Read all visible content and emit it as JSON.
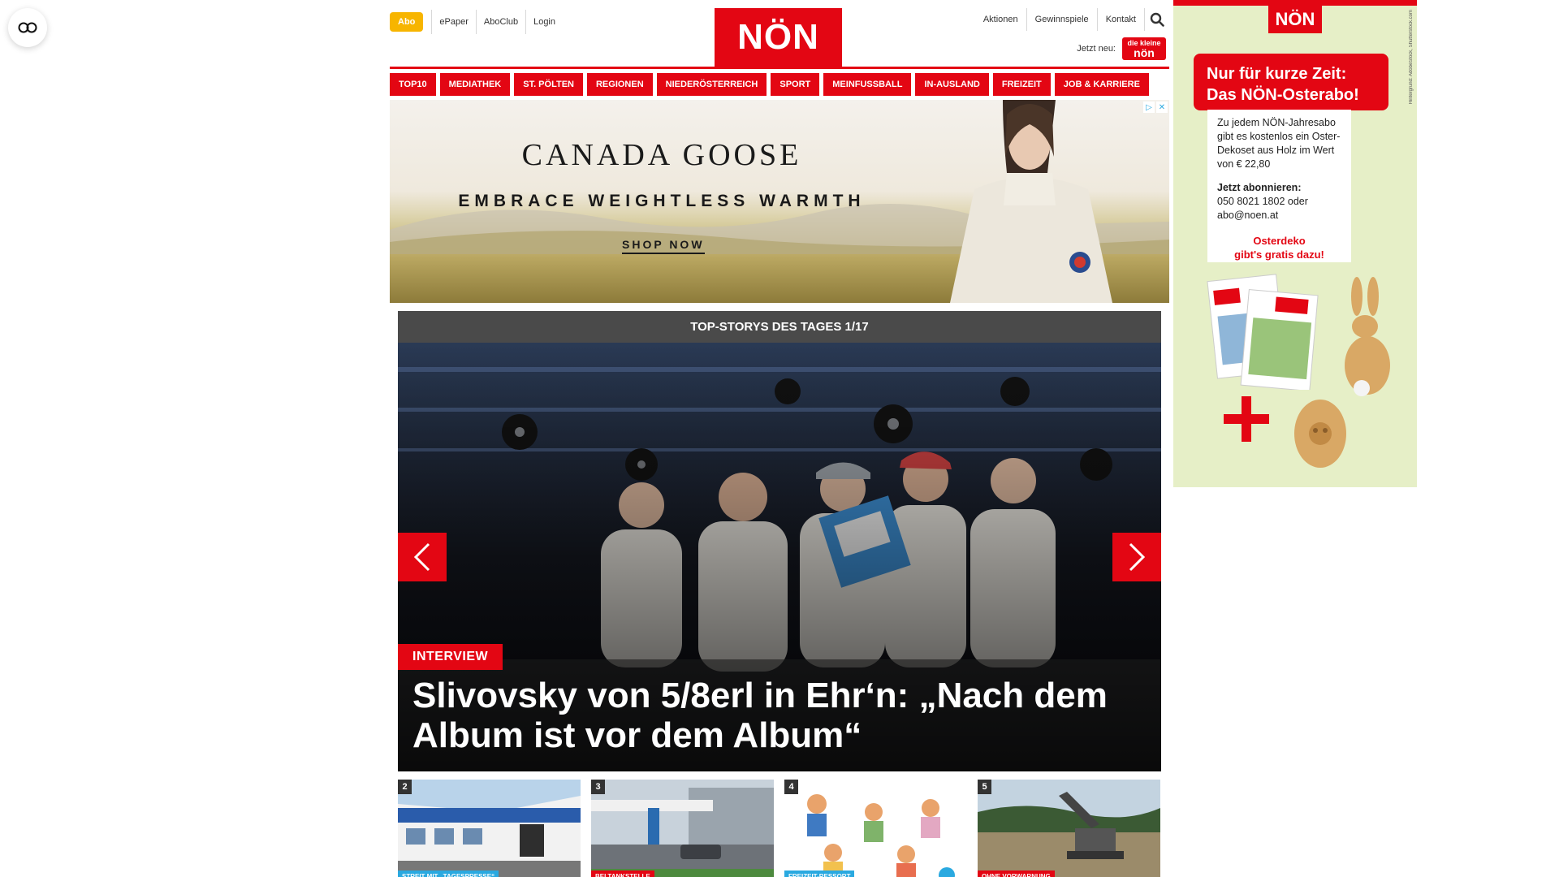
{
  "header": {
    "abo_label": "Abo",
    "links_left": [
      "ePaper",
      "AboClub",
      "Login"
    ],
    "logo_text": "NÖN",
    "links_right": [
      "Aktionen",
      "Gewinnspiele",
      "Kontakt"
    ],
    "jetzt_neu_label": "Jetzt neu:",
    "kleine_logo_top": "die kleine",
    "kleine_logo_bottom": "nön"
  },
  "categories": [
    "TOP10",
    "MEDIATHEK",
    "ST. PÖLTEN",
    "REGIONEN",
    "NIEDERÖSTERREICH",
    "SPORT",
    "MEINFUSSBALL",
    "IN-AUSLAND",
    "FREIZEIT",
    "JOB & KARRIERE"
  ],
  "ad_banner": {
    "brand": "CANADA GOOSE",
    "tagline": "EMBRACE WEIGHTLESS WARMTH",
    "cta": "SHOP NOW"
  },
  "top_stories": {
    "heading": "TOP-STORYS DES TAGES 1/17",
    "hero": {
      "tag": "INTERVIEW",
      "title": "Slivovsky von 5/8erl in Ehr‘n: „Nach dem Album ist vor dem Album“"
    },
    "thumbs": [
      {
        "num": "2",
        "tag": "STREIT MIT „TAGESPRESSE“",
        "tag_color": "#2aa9e0"
      },
      {
        "num": "3",
        "tag": "BELTANKSTELLE",
        "tag_color": "#e30613"
      },
      {
        "num": "4",
        "tag": "FREIZEIT-RESSORT",
        "tag_color": "#2aa9e0"
      },
      {
        "num": "5",
        "tag": "OHNE VORWARNUNG",
        "tag_color": "#e30613"
      }
    ]
  },
  "sky_ad": {
    "logo": "NÖN",
    "credit": "Hintergrund: AdobeStock, Shutterstock.com",
    "headline_1": "Nur für kurze Zeit:",
    "headline_2": "Das NÖN-Osterabo!",
    "body": "Zu jedem NÖN-Jahresabo gibt es kostenlos ein Oster-Dekoset aus Holz im Wert von € 22,80",
    "subscribe_label": "Jetzt abonnieren:",
    "contact": "050 8021 1802 oder abo@noen.at",
    "promo_1": "Osterdeko",
    "promo_2": "gibt's gratis dazu!"
  },
  "colors": {
    "brand_red": "#e30613",
    "abo_yellow": "#f7b500",
    "stories_header": "#4a4a4a"
  },
  "icons": [
    "accessibility-glasses-icon",
    "search-icon",
    "chevron-left-icon",
    "chevron-right-icon",
    "ad-choices-icon",
    "ad-close-icon"
  ]
}
